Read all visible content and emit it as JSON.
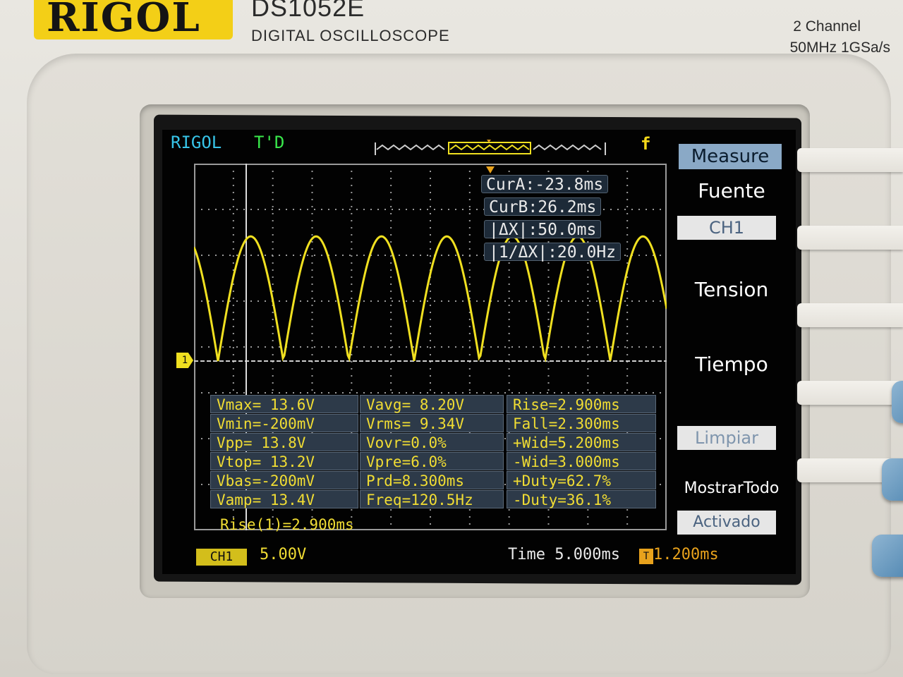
{
  "instrument": {
    "brand": "RIGOL",
    "model": "DS1052E",
    "subtitle": "DIGITAL OSCILLOSCOPE",
    "spec_channels": "2 Channel",
    "spec_bandwidth": "50MHz 1GSa/s"
  },
  "status": {
    "brand_label": "RIGOL",
    "trigger_status": "T'D",
    "trigger_icon": "f"
  },
  "cursors": {
    "cur_a": "CurA:-23.8ms",
    "cur_b": "CurB:26.2ms",
    "delta_x": "|ΔX|:50.0ms",
    "inv_delta_x": "|1/ΔX|:20.0Hz"
  },
  "measurements": [
    [
      "Vmax= 13.6V",
      "Vavg= 8.20V",
      "Rise=2.900ms"
    ],
    [
      "Vmin=-200mV",
      "Vrms= 9.34V",
      "Fall=2.300ms"
    ],
    [
      "Vpp= 13.8V",
      "Vovr=0.0%",
      "+Wid=5.200ms"
    ],
    [
      "Vtop= 13.2V",
      "Vpre=6.0%",
      "-Wid=3.000ms"
    ],
    [
      "Vbas=-200mV",
      "Prd=8.300ms",
      "+Duty=62.7%"
    ],
    [
      "Vamp= 13.4V",
      "Freq=120.5Hz",
      "-Duty=36.1%"
    ]
  ],
  "rise_readout": "Rise(1)=2.900ms",
  "channel": {
    "marker": "1",
    "chip": "CH1",
    "scale": "5.00V"
  },
  "timebase": {
    "label": "Time 5.000ms",
    "trigger_offset": "1.200ms"
  },
  "menu": {
    "title": "Measure",
    "source_label": "Fuente",
    "source_value": "CH1",
    "voltage_label": "Tension",
    "time_label": "Tiempo",
    "clear_label": "Limpiar",
    "show_all_label": "MostrarTodo",
    "show_all_value": "Activado"
  },
  "colors": {
    "trace": "#f0e020",
    "measure_text": "#f1dd33",
    "menu_title_bg": "#8aa9c6"
  }
}
